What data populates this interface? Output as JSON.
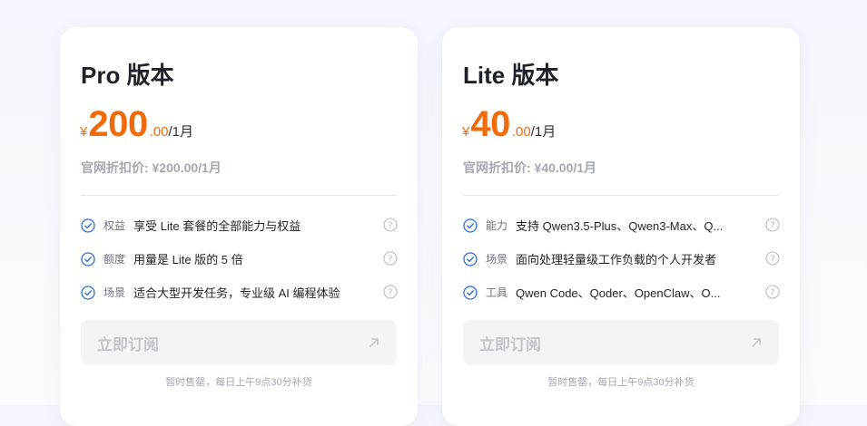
{
  "plans": [
    {
      "title": "Pro 版本",
      "currency": "¥",
      "amount": "200",
      "decimal": ".00",
      "unit": "/1月",
      "official_price": "官网折扣价: ¥200.00/1月",
      "features": [
        {
          "tag": "权益",
          "text": "享受 Lite 套餐的全部能力与权益"
        },
        {
          "tag": "额度",
          "text": "用量是 Lite 版的 5 倍"
        },
        {
          "tag": "场景",
          "text": "适合大型开发任务，专业级 AI 编程体验"
        }
      ],
      "button_label": "立即订阅",
      "restock_note": "暂时售罄，每日上午9点30分补货"
    },
    {
      "title": "Lite 版本",
      "currency": "¥",
      "amount": "40",
      "decimal": ".00",
      "unit": "/1月",
      "official_price": "官网折扣价: ¥40.00/1月",
      "features": [
        {
          "tag": "能力",
          "text": "支持 Qwen3.5-Plus、Qwen3-Max、Q..."
        },
        {
          "tag": "场景",
          "text": "面向处理轻量级工作负载的个人开发者"
        },
        {
          "tag": "工具",
          "text": "Qwen Code、Qoder、OpenClaw、O..."
        }
      ],
      "button_label": "立即订阅",
      "restock_note": "暂时售罄，每日上午9点30分补货"
    }
  ],
  "icons": {
    "check": "check-circle-icon",
    "help": "question-circle-icon",
    "arrow": "arrow-up-right-icon"
  },
  "colors": {
    "price": "#f26b0a",
    "check": "#2f6fd6",
    "muted": "#a3a8b1",
    "button_bg": "#f3f4f6",
    "button_text": "#c2c6cc"
  }
}
